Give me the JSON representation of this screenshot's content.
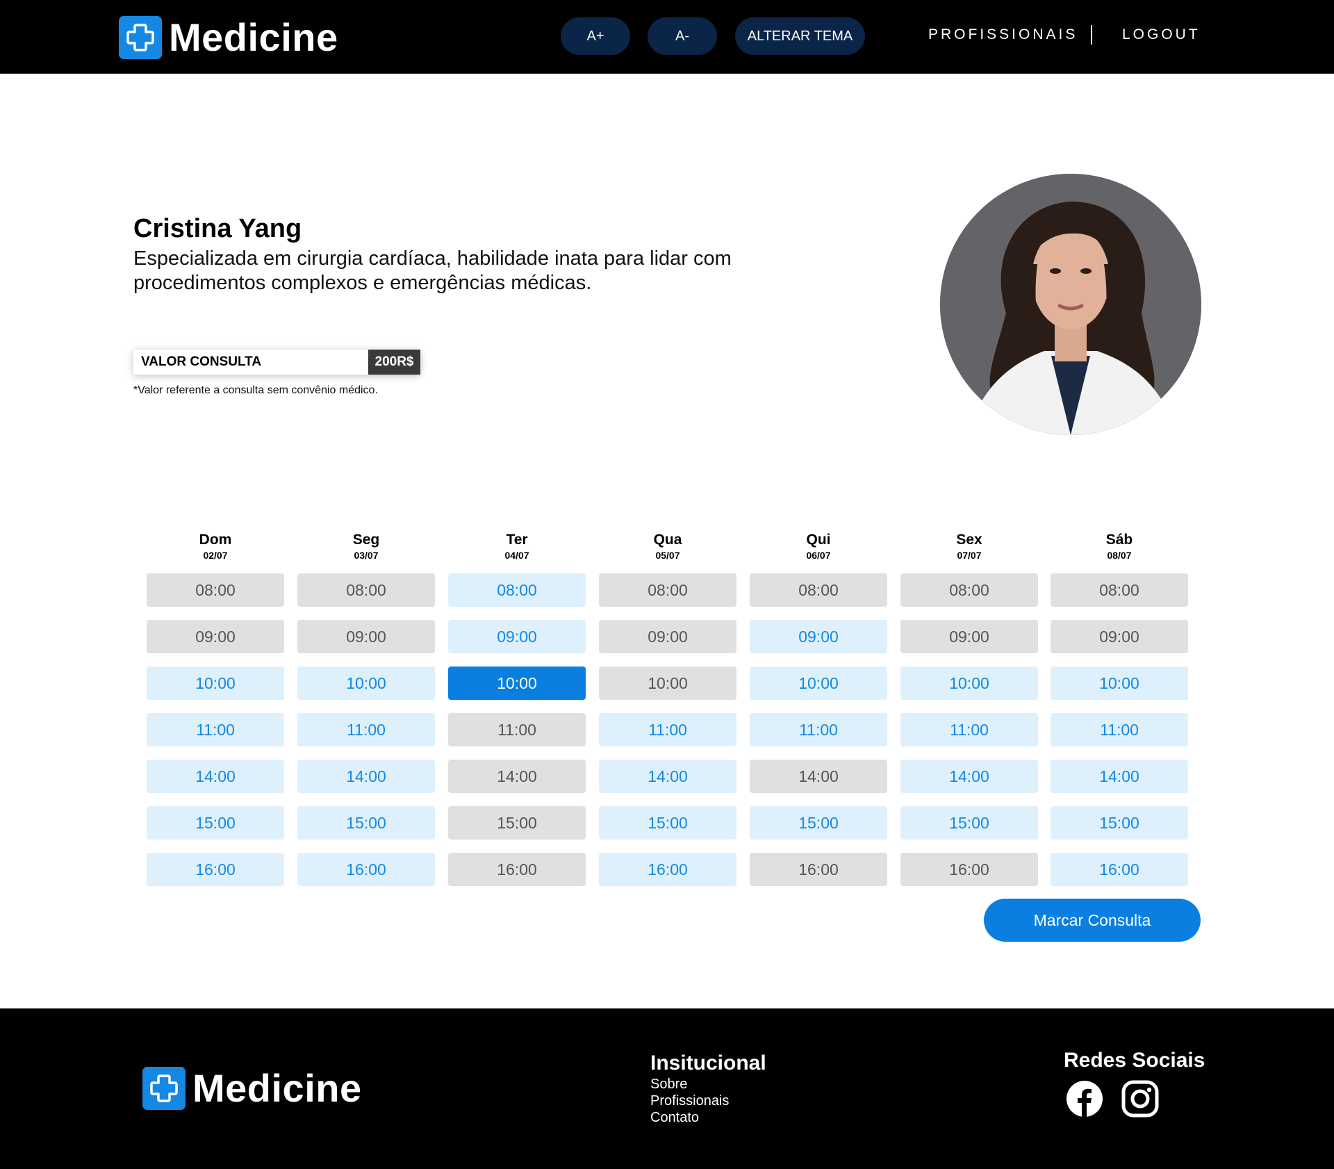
{
  "header": {
    "brand": "Medicine",
    "buttons": {
      "font_increase": "A+",
      "font_decrease": "A-",
      "theme": "ALTERAR TEMA"
    },
    "nav": {
      "professionals": "PROFISSIONAIS",
      "logout": "LOGOUT"
    }
  },
  "doctor": {
    "name": "Cristina Yang",
    "description": "Especializada em cirurgia cardíaca, habilidade inata para lidar com procedimentos complexos e emergências médicas.",
    "price_label": "VALOR CONSULTA",
    "price_value": "200R$",
    "price_note": "*Valor referente a consulta sem convênio médico."
  },
  "schedule": {
    "days": [
      {
        "name": "Dom",
        "date": "02/07"
      },
      {
        "name": "Seg",
        "date": "03/07"
      },
      {
        "name": "Ter",
        "date": "04/07"
      },
      {
        "name": "Qua",
        "date": "05/07"
      },
      {
        "name": "Qui",
        "date": "06/07"
      },
      {
        "name": "Sex",
        "date": "07/07"
      },
      {
        "name": "Sáb",
        "date": "08/07"
      }
    ],
    "times": [
      "08:00",
      "09:00",
      "10:00",
      "11:00",
      "14:00",
      "15:00",
      "16:00"
    ],
    "status": [
      [
        "busy",
        "busy",
        "free",
        "busy",
        "busy",
        "busy",
        "busy"
      ],
      [
        "busy",
        "busy",
        "free",
        "busy",
        "free",
        "busy",
        "busy"
      ],
      [
        "free",
        "free",
        "selected",
        "busy",
        "free",
        "free",
        "free"
      ],
      [
        "free",
        "free",
        "busy",
        "free",
        "free",
        "free",
        "free"
      ],
      [
        "free",
        "free",
        "busy",
        "free",
        "busy",
        "free",
        "free"
      ],
      [
        "free",
        "free",
        "busy",
        "free",
        "free",
        "free",
        "free"
      ],
      [
        "free",
        "free",
        "busy",
        "free",
        "busy",
        "busy",
        "free"
      ]
    ],
    "book_button": "Marcar Consulta"
  },
  "footer": {
    "brand": "Medicine",
    "institutional_title": "Insitucional",
    "links": [
      "Sobre",
      "Profissionais",
      "Contato"
    ],
    "social_title": "Redes Sociais",
    "social_icons": [
      "facebook-icon",
      "instagram-icon"
    ]
  },
  "colors": {
    "brand_blue": "#1488e3",
    "header_button": "#0a2547",
    "selected_slot": "#0a7fe0",
    "free_slot_bg": "#def0fc",
    "busy_slot_bg": "#e0e0e0"
  }
}
